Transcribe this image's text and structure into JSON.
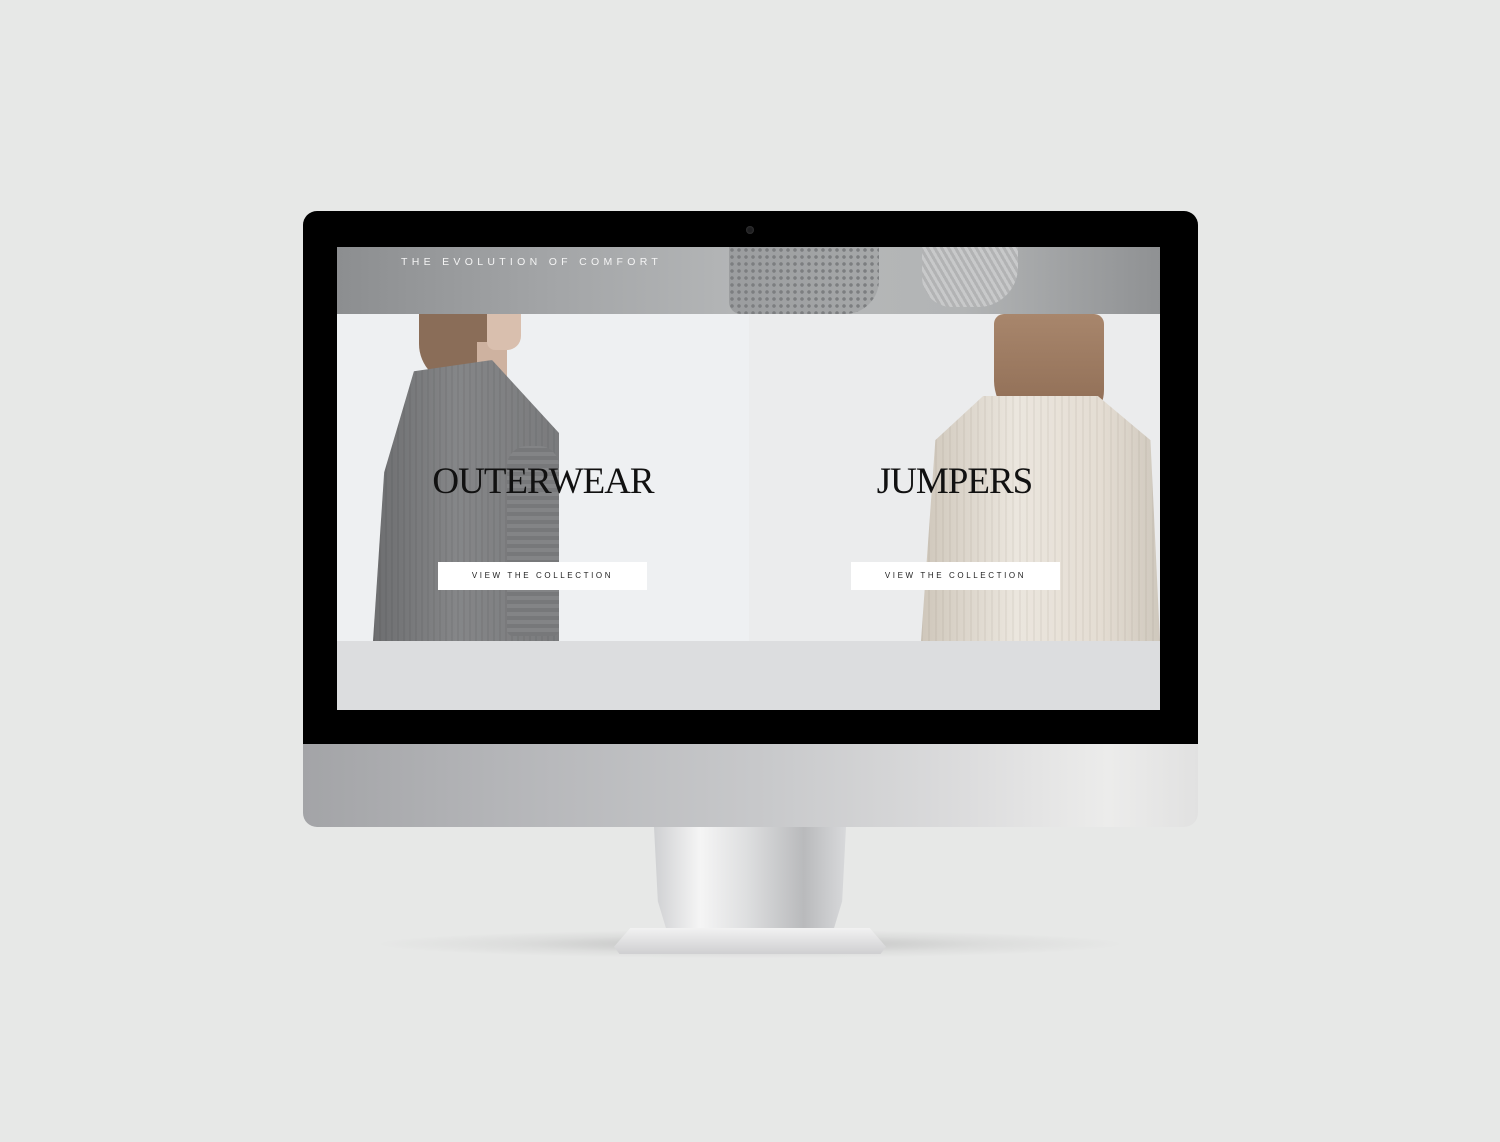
{
  "hero": {
    "tagline": "THE EVOLUTION OF COMFORT"
  },
  "collections": [
    {
      "title": "OUTERWEAR",
      "button_label": "VIEW THE COLLECTION"
    },
    {
      "title": "JUMPERS",
      "button_label": "VIEW THE COLLECTION"
    }
  ],
  "colors": {
    "background": "#e7e8e7",
    "bezel": "#000000",
    "heading": "#111111",
    "button_bg": "#ffffff",
    "footer_band": "#dcdddf"
  }
}
